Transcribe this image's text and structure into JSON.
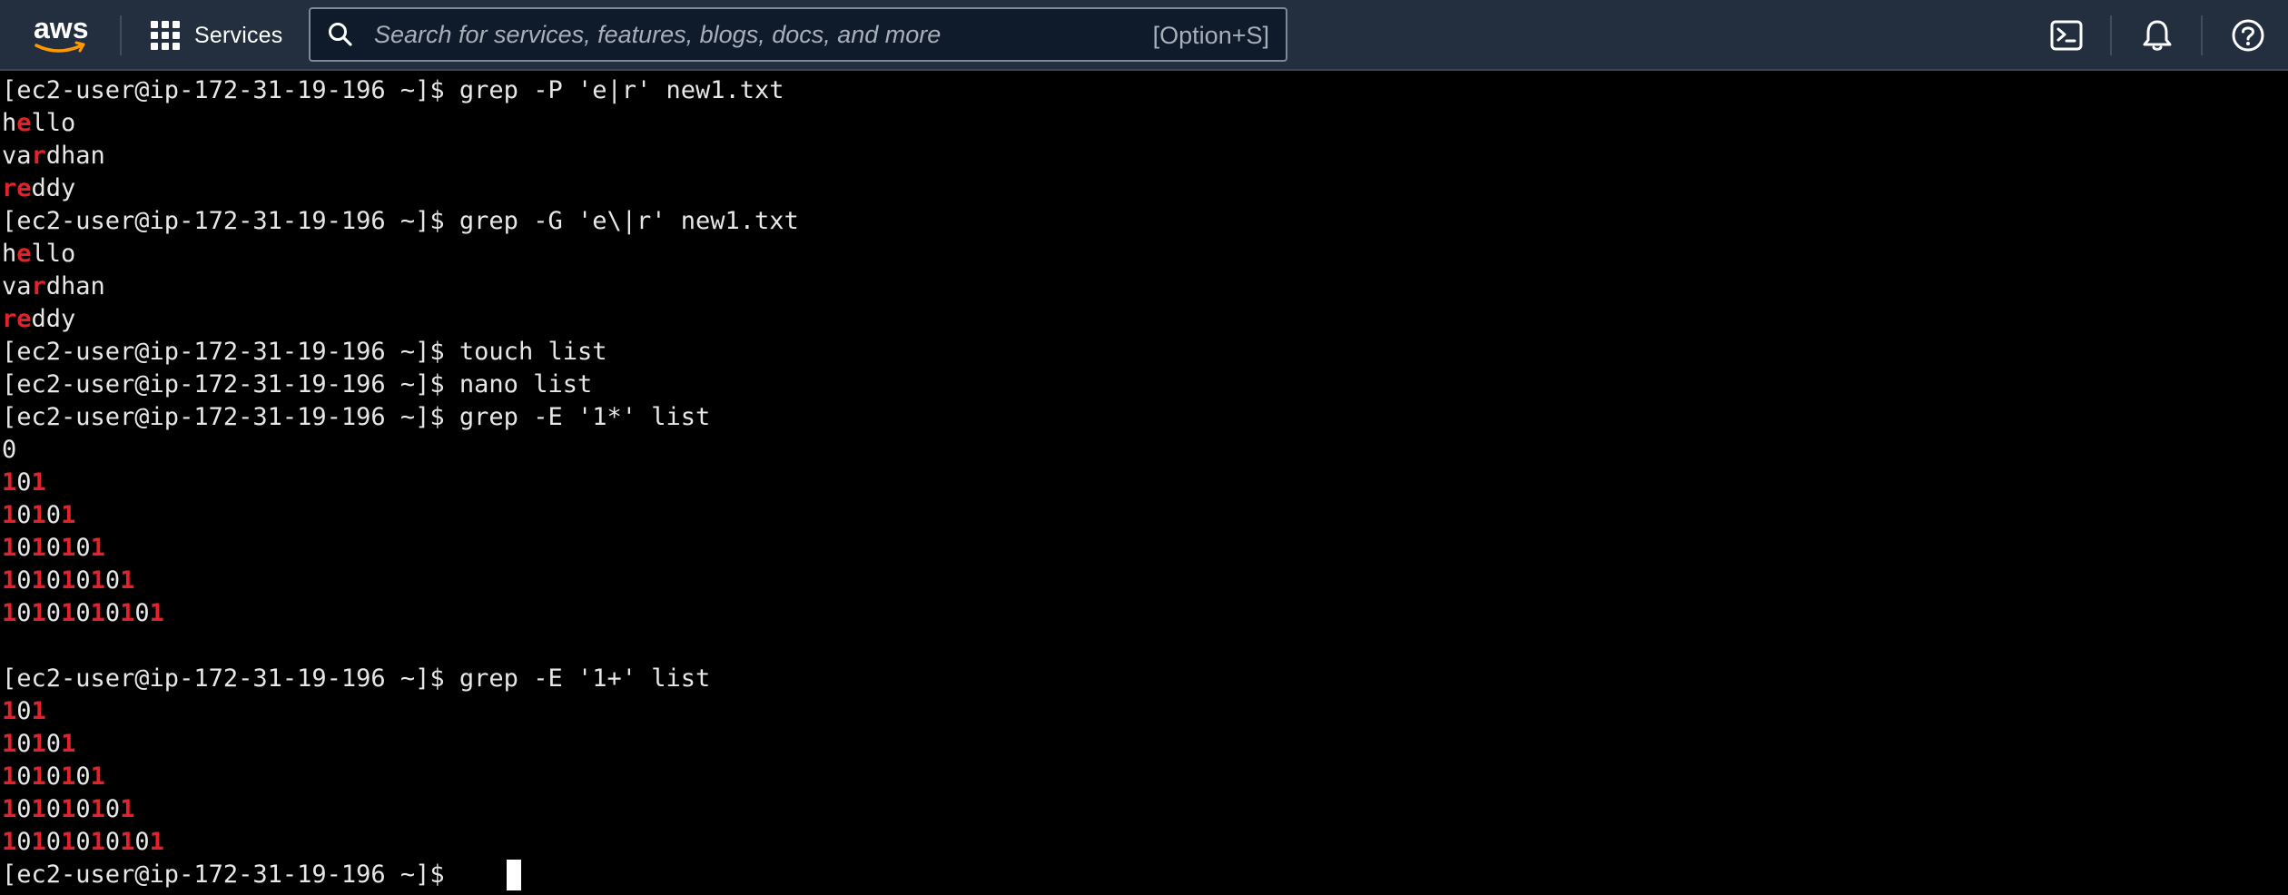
{
  "nav": {
    "logo_text": "aws",
    "services_label": "Services",
    "search": {
      "placeholder": "Search for services, features, blogs, docs, and more",
      "value": "",
      "shortcut": "[Option+S]"
    },
    "icons": [
      "cloudshell-icon",
      "bell-icon",
      "help-icon"
    ],
    "colors": {
      "bar": "#232f3e",
      "logo_smile": "#ff9900"
    }
  },
  "terminal": {
    "colors": {
      "background": "#000000",
      "text": "#e7e7e7",
      "match": "#e5212c"
    },
    "lines": [
      {
        "segments": [
          {
            "t": "[ec2-user@ip-172-31-19-196 ~]$ grep -P 'e|r' new1.txt"
          }
        ]
      },
      {
        "segments": [
          {
            "t": "h"
          },
          {
            "t": "e",
            "m": true
          },
          {
            "t": "llo"
          }
        ]
      },
      {
        "segments": [
          {
            "t": "va"
          },
          {
            "t": "r",
            "m": true
          },
          {
            "t": "dhan"
          }
        ]
      },
      {
        "segments": [
          {
            "t": "re",
            "m": true
          },
          {
            "t": "ddy"
          }
        ]
      },
      {
        "segments": [
          {
            "t": "[ec2-user@ip-172-31-19-196 ~]$ grep -G 'e\\|r' new1.txt"
          }
        ]
      },
      {
        "segments": [
          {
            "t": "h"
          },
          {
            "t": "e",
            "m": true
          },
          {
            "t": "llo"
          }
        ]
      },
      {
        "segments": [
          {
            "t": "va"
          },
          {
            "t": "r",
            "m": true
          },
          {
            "t": "dhan"
          }
        ]
      },
      {
        "segments": [
          {
            "t": "re",
            "m": true
          },
          {
            "t": "ddy"
          }
        ]
      },
      {
        "segments": [
          {
            "t": "[ec2-user@ip-172-31-19-196 ~]$ touch list"
          }
        ]
      },
      {
        "segments": [
          {
            "t": "[ec2-user@ip-172-31-19-196 ~]$ nano list"
          }
        ]
      },
      {
        "segments": [
          {
            "t": "[ec2-user@ip-172-31-19-196 ~]$ grep -E '1*' list"
          }
        ]
      },
      {
        "segments": [
          {
            "t": "0"
          }
        ]
      },
      {
        "segments": [
          {
            "t": "1",
            "m": true
          },
          {
            "t": "0"
          },
          {
            "t": "1",
            "m": true
          }
        ]
      },
      {
        "segments": [
          {
            "t": "1",
            "m": true
          },
          {
            "t": "0"
          },
          {
            "t": "1",
            "m": true
          },
          {
            "t": "0"
          },
          {
            "t": "1",
            "m": true
          }
        ]
      },
      {
        "segments": [
          {
            "t": "1",
            "m": true
          },
          {
            "t": "0"
          },
          {
            "t": "1",
            "m": true
          },
          {
            "t": "0"
          },
          {
            "t": "1",
            "m": true
          },
          {
            "t": "0"
          },
          {
            "t": "1",
            "m": true
          }
        ]
      },
      {
        "segments": [
          {
            "t": "1",
            "m": true
          },
          {
            "t": "0"
          },
          {
            "t": "1",
            "m": true
          },
          {
            "t": "0"
          },
          {
            "t": "1",
            "m": true
          },
          {
            "t": "0"
          },
          {
            "t": "1",
            "m": true
          },
          {
            "t": "0"
          },
          {
            "t": "1",
            "m": true
          }
        ]
      },
      {
        "segments": [
          {
            "t": "1",
            "m": true
          },
          {
            "t": "0"
          },
          {
            "t": "1",
            "m": true
          },
          {
            "t": "0"
          },
          {
            "t": "1",
            "m": true
          },
          {
            "t": "0"
          },
          {
            "t": "1",
            "m": true
          },
          {
            "t": "0"
          },
          {
            "t": "1",
            "m": true
          },
          {
            "t": "0"
          },
          {
            "t": "1",
            "m": true
          }
        ]
      },
      {
        "segments": [
          {
            "t": ""
          }
        ]
      },
      {
        "segments": [
          {
            "t": "[ec2-user@ip-172-31-19-196 ~]$ grep -E '1+' list"
          }
        ]
      },
      {
        "segments": [
          {
            "t": "1",
            "m": true
          },
          {
            "t": "0"
          },
          {
            "t": "1",
            "m": true
          }
        ]
      },
      {
        "segments": [
          {
            "t": "1",
            "m": true
          },
          {
            "t": "0"
          },
          {
            "t": "1",
            "m": true
          },
          {
            "t": "0"
          },
          {
            "t": "1",
            "m": true
          }
        ]
      },
      {
        "segments": [
          {
            "t": "1",
            "m": true
          },
          {
            "t": "0"
          },
          {
            "t": "1",
            "m": true
          },
          {
            "t": "0"
          },
          {
            "t": "1",
            "m": true
          },
          {
            "t": "0"
          },
          {
            "t": "1",
            "m": true
          }
        ]
      },
      {
        "segments": [
          {
            "t": "1",
            "m": true
          },
          {
            "t": "0"
          },
          {
            "t": "1",
            "m": true
          },
          {
            "t": "0"
          },
          {
            "t": "1",
            "m": true
          },
          {
            "t": "0"
          },
          {
            "t": "1",
            "m": true
          },
          {
            "t": "0"
          },
          {
            "t": "1",
            "m": true
          }
        ]
      },
      {
        "segments": [
          {
            "t": "1",
            "m": true
          },
          {
            "t": "0"
          },
          {
            "t": "1",
            "m": true
          },
          {
            "t": "0"
          },
          {
            "t": "1",
            "m": true
          },
          {
            "t": "0"
          },
          {
            "t": "1",
            "m": true
          },
          {
            "t": "0"
          },
          {
            "t": "1",
            "m": true
          },
          {
            "t": "0"
          },
          {
            "t": "1",
            "m": true
          }
        ]
      },
      {
        "segments": [
          {
            "t": "[ec2-user@ip-172-31-19-196 ~]$ "
          }
        ]
      }
    ]
  }
}
